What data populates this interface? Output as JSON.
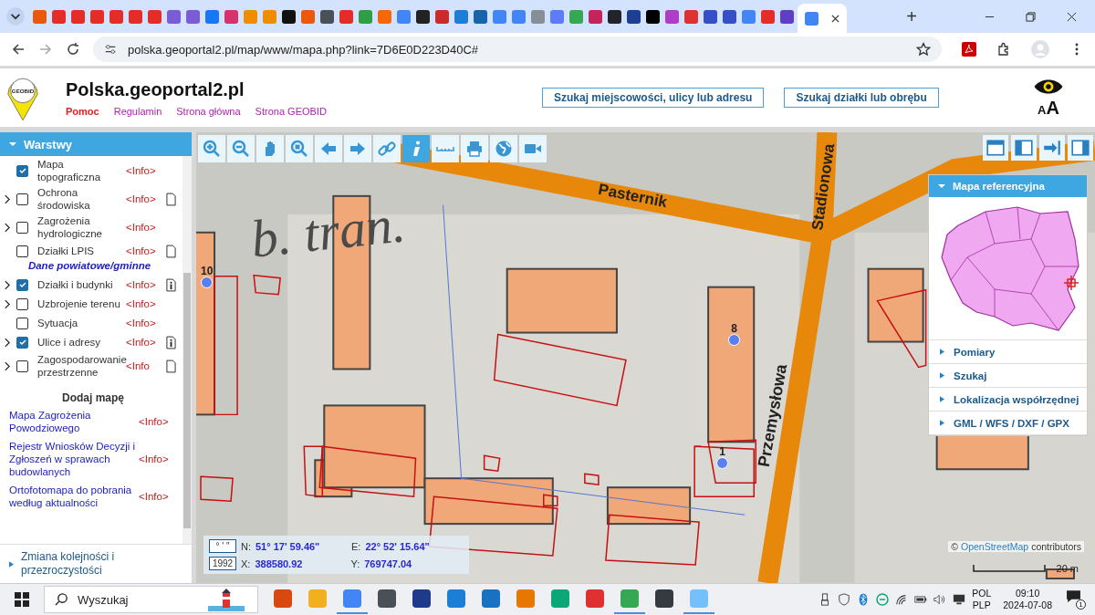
{
  "browser": {
    "tabs": [
      {
        "color": "#e8590c",
        "selected": false
      },
      {
        "color": "#e52d27",
        "selected": false
      },
      {
        "color": "#e52d27",
        "selected": false
      },
      {
        "color": "#e52d27",
        "selected": false
      },
      {
        "color": "#e52d27",
        "selected": false
      },
      {
        "color": "#e52d27",
        "selected": false
      },
      {
        "color": "#e52d27",
        "selected": false
      },
      {
        "color": "#7b5cd6",
        "selected": false
      },
      {
        "color": "#7b5cd6",
        "selected": false
      },
      {
        "color": "#1877f2",
        "selected": false
      },
      {
        "color": "#d6336c",
        "selected": false
      },
      {
        "color": "#f08c00",
        "selected": false
      },
      {
        "color": "#f08c00",
        "selected": false
      },
      {
        "color": "#111111",
        "selected": false
      },
      {
        "color": "#e8590c",
        "selected": false
      },
      {
        "color": "#495057",
        "selected": false
      },
      {
        "color": "#e52d27",
        "selected": false
      },
      {
        "color": "#2f9e44",
        "selected": false
      },
      {
        "color": "#f76707",
        "selected": false
      },
      {
        "color": "#4285f4",
        "selected": false
      },
      {
        "color": "#222222",
        "selected": false
      },
      {
        "color": "#c92a2a",
        "selected": false
      },
      {
        "color": "#1c7ed6",
        "selected": false
      },
      {
        "color": "#1864ab",
        "selected": false
      },
      {
        "color": "#4285f4",
        "selected": false
      },
      {
        "color": "#4285f4",
        "selected": false
      },
      {
        "color": "#868e96",
        "selected": false
      },
      {
        "color": "#5c7cfa",
        "selected": false
      },
      {
        "color": "#34a853",
        "selected": false
      },
      {
        "color": "#c2255c",
        "selected": false
      },
      {
        "color": "#212529",
        "selected": false
      },
      {
        "color": "#1c3f94",
        "selected": false
      },
      {
        "color": "#000000",
        "selected": false
      },
      {
        "color": "#ae3ec9",
        "selected": false
      },
      {
        "color": "#e03131",
        "selected": false
      },
      {
        "color": "#364fc7",
        "selected": false
      },
      {
        "color": "#364fc7",
        "selected": false
      },
      {
        "color": "#4285f4",
        "selected": false
      },
      {
        "color": "#e52d27",
        "selected": false
      },
      {
        "color": "#5f3dc4",
        "selected": false
      },
      {
        "color": "#4285f4",
        "selected": true
      }
    ],
    "new_tab": "+",
    "url": "polska.geoportal2.pl/map/www/mapa.php?link=7D6E0D223D40C#"
  },
  "header": {
    "logo_text": "GEOBID",
    "title": "Polska.geoportal2.pl",
    "links": [
      {
        "label": "Pomoc",
        "color": "#e02020"
      },
      {
        "label": "Regulamin",
        "color": "#b020b0"
      },
      {
        "label": "Strona główna",
        "color": "#b020b0"
      },
      {
        "label": "Strona GEOBID",
        "color": "#b020b0"
      }
    ],
    "search_buttons": [
      "Szukaj miejscowości, ulicy lub adresu",
      "Szukaj działki lub obrębu"
    ],
    "font_size_letters": [
      "A",
      "A"
    ]
  },
  "layers_panel": {
    "title": "Warstwy",
    "expanded": true,
    "items": [
      {
        "kind": "layer",
        "label": "Mapa topograficzna",
        "checked": true,
        "expandable": false,
        "info": "<Info>",
        "document": false
      },
      {
        "kind": "layer",
        "label": "Ochrona środowiska",
        "checked": false,
        "expandable": true,
        "info": "<Info>",
        "document": true,
        "document_info": false
      },
      {
        "kind": "layer",
        "label": "Zagrożenia hydrologiczne",
        "checked": false,
        "expandable": true,
        "info": "<Info>",
        "document": false
      },
      {
        "kind": "layer",
        "label": "Działki LPIS",
        "checked": false,
        "expandable": false,
        "info": "<Info>",
        "document": true,
        "document_info": false
      },
      {
        "kind": "section",
        "label": "Dane powiatowe/gminne"
      },
      {
        "kind": "layer",
        "label": "Działki i budynki",
        "checked": true,
        "expandable": true,
        "info": "<Info>",
        "document": true,
        "document_info": true
      },
      {
        "kind": "layer",
        "label": "Uzbrojenie terenu",
        "checked": false,
        "expandable": true,
        "info": "<Info>",
        "document": false
      },
      {
        "kind": "layer",
        "label": "Sytuacja",
        "checked": false,
        "expandable": false,
        "info": "<Info>",
        "document": false
      },
      {
        "kind": "layer",
        "label": "Ulice i adresy",
        "checked": true,
        "expandable": true,
        "info": "<Info>",
        "document": true,
        "document_info": true
      },
      {
        "kind": "layer",
        "label": "Zagospodarowanie przestrzenne",
        "checked": false,
        "expandable": true,
        "info": "<Info",
        "document": true,
        "document_info": false
      }
    ],
    "add_map_title": "Dodaj mapę",
    "add_maps": [
      {
        "label": "Mapa Zagrożenia Powodziowego",
        "info": "<Info>"
      },
      {
        "label": "Rejestr Wniosków Decyzji i Zgłoszeń w sprawach budowlanych",
        "info": "<Info>"
      },
      {
        "label": "Ortofotomapa do pobrania według aktualności",
        "info": "<Info>"
      }
    ],
    "footer": "Zmiana kolejności i przezroczystości"
  },
  "map_toolbar": [
    {
      "kind": "zoom-in",
      "selected": false
    },
    {
      "kind": "zoom-out",
      "selected": false
    },
    {
      "kind": "pan",
      "selected": false
    },
    {
      "kind": "zoom-box",
      "selected": false
    },
    {
      "kind": "back",
      "selected": false
    },
    {
      "kind": "forward",
      "selected": false
    },
    {
      "kind": "link",
      "selected": false
    },
    {
      "kind": "info",
      "selected": true
    },
    {
      "kind": "measure",
      "selected": false
    },
    {
      "kind": "print",
      "selected": false
    },
    {
      "kind": "globe",
      "selected": false
    },
    {
      "kind": "camera",
      "selected": false
    }
  ],
  "map": {
    "street_labels": [
      "Pasternik",
      "Stadionowa",
      "Przemysłowa"
    ],
    "area_label": "b. tran.",
    "points": [
      "10",
      "8",
      "1"
    ],
    "attribution_link": "OpenStreetMap",
    "attribution_prefix": "©",
    "attribution_suffix": "contributors",
    "scale": "20 m"
  },
  "coordinates": {
    "format_button": "° ' \"",
    "system_button": "1992",
    "n_label": "N:",
    "n_value": "51° 17' 59.46\"",
    "e_label": "E:",
    "e_value": "22° 52' 15.64\"",
    "x_label": "X:",
    "x_value": "388580.92",
    "y_label": "Y:",
    "y_value": "769747.04"
  },
  "reference_panel": {
    "title": "Mapa referencyjna",
    "expanded": true,
    "items": [
      "Pomiary",
      "Szukaj",
      "Lokalizacja współrzędnej",
      "GML / WFS / DXF / GPX"
    ]
  },
  "taskbar": {
    "search_placeholder": "Wyszukaj",
    "apps": [
      {
        "color": "#d9480f",
        "selected": false
      },
      {
        "color": "#f2b01e",
        "selected": false
      },
      {
        "color": "#4285f4",
        "selected": true
      },
      {
        "color": "#495057",
        "selected": false
      },
      {
        "color": "#1e3a8a",
        "selected": false
      },
      {
        "color": "#1c7ed6",
        "selected": false
      },
      {
        "color": "#1971c2",
        "selected": false
      },
      {
        "color": "#e67700",
        "selected": false
      },
      {
        "color": "#0ca678",
        "selected": false
      },
      {
        "color": "#e03131",
        "selected": false
      },
      {
        "color": "#34a853",
        "selected": true
      },
      {
        "color": "#343a40",
        "selected": false
      },
      {
        "color": "#74c0fc",
        "selected": true
      }
    ],
    "language": [
      "POL",
      "PLP"
    ],
    "time": "09:10",
    "date": "2024-07-08",
    "notifications": "1"
  }
}
